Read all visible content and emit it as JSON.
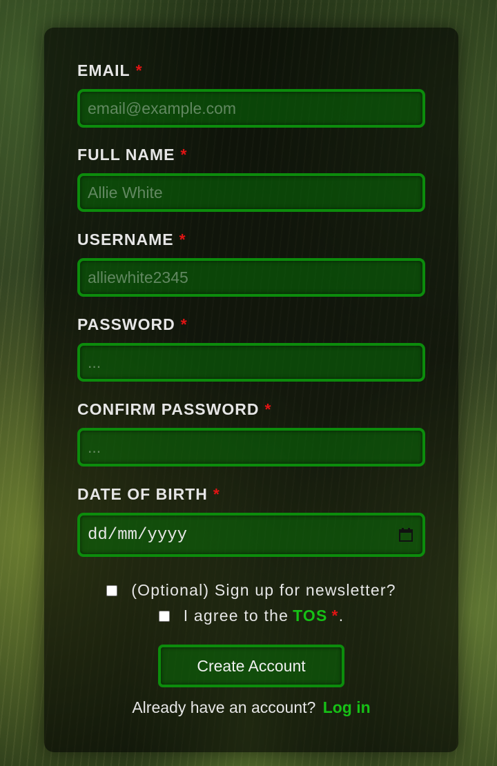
{
  "form": {
    "fields": [
      {
        "label": "EMAIL",
        "required_mark": "*",
        "placeholder": "email@example.com"
      },
      {
        "label": "FULL NAME",
        "required_mark": "*",
        "placeholder": "Allie White"
      },
      {
        "label": "USERNAME",
        "required_mark": "*",
        "placeholder": "alliewhite2345"
      },
      {
        "label": "PASSWORD",
        "required_mark": "*",
        "placeholder": "..."
      },
      {
        "label": "CONFIRM PASSWORD",
        "required_mark": "*",
        "placeholder": "..."
      },
      {
        "label": "DATE OF BIRTH",
        "required_mark": "*",
        "placeholder": "dd/mm/yyyy"
      }
    ],
    "newsletter_label": "(Optional) Sign up for newsletter?",
    "tos": {
      "prefix": "I agree to the",
      "link": "TOS",
      "required_mark": "*",
      "suffix": "."
    },
    "submit_label": "Create Account",
    "login_prompt": "Already have an account?",
    "login_link": "Log in"
  },
  "colors": {
    "accent": "#16c016",
    "required": "#e01414",
    "field_border": "#0c8c0c"
  }
}
